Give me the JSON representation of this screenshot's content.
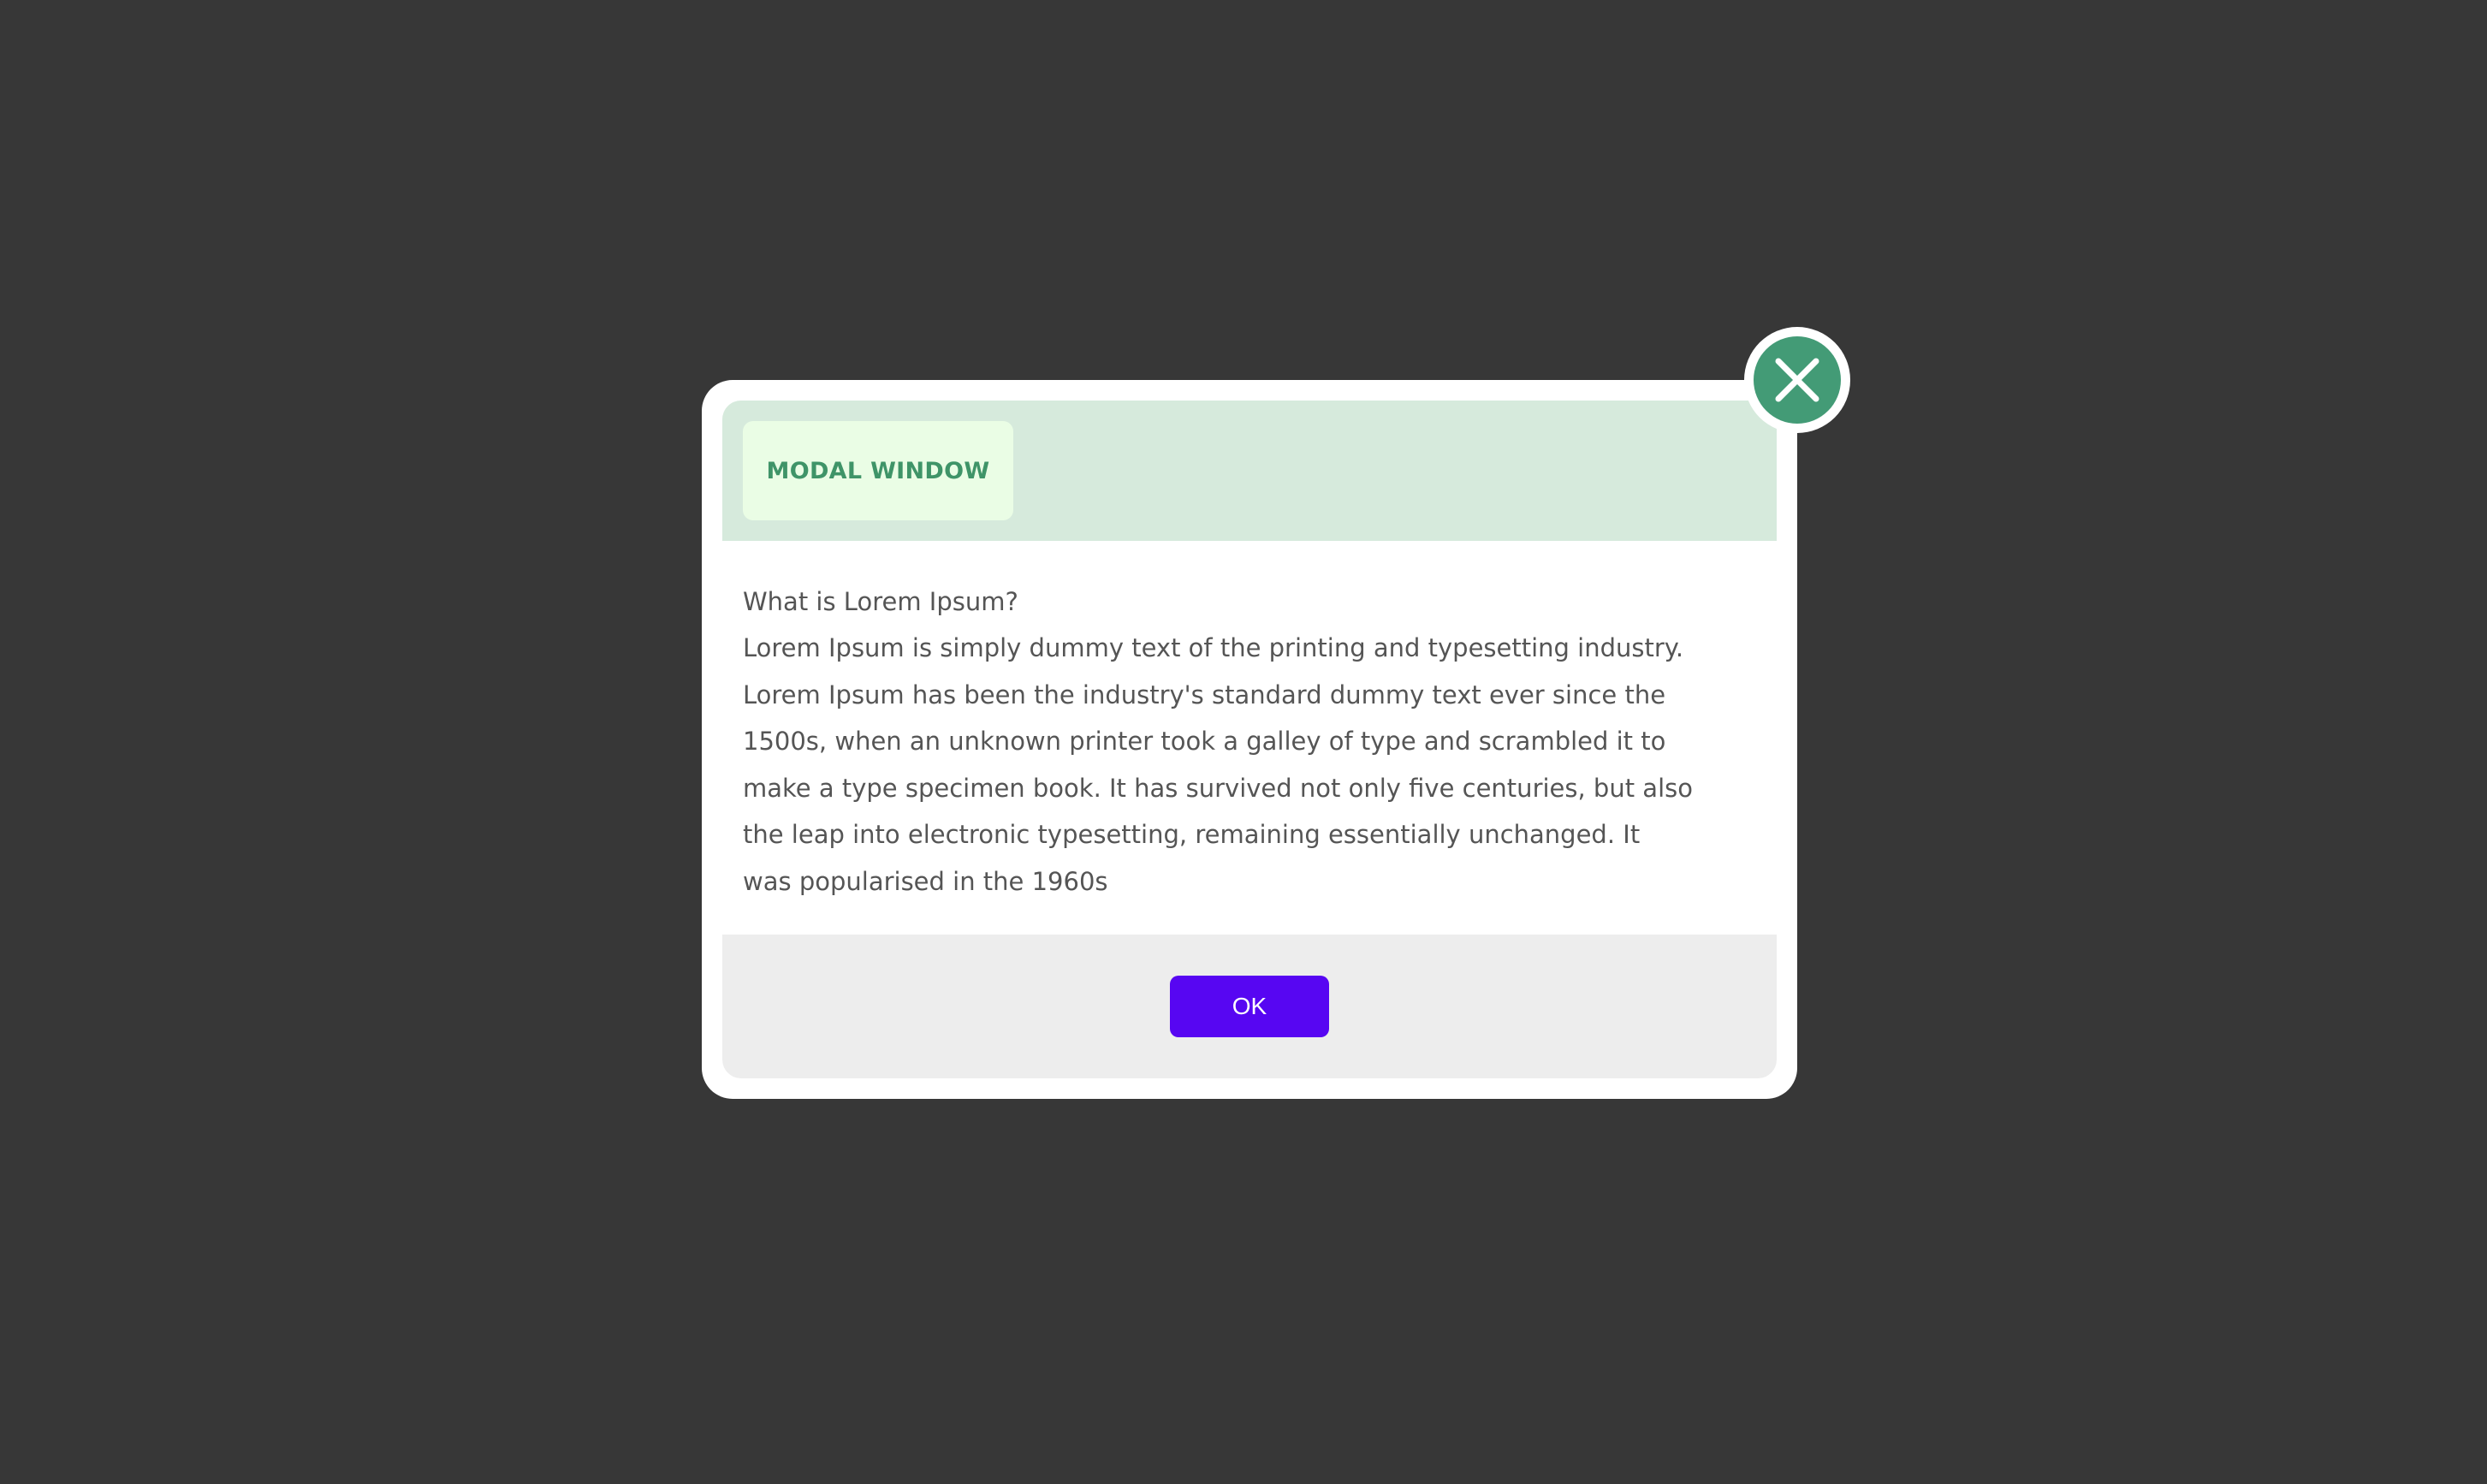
{
  "modal": {
    "title": "MODAL WINDOW",
    "body_heading": "What is Lorem Ipsum?",
    "body_text": "Lorem Ipsum is simply dummy text of the printing and typesetting industry. Lorem Ipsum has been the industry's standard dummy text ever since the 1500s, when an unknown printer took a galley of type and scrambled it to make a type specimen book. It has survived not only five centuries, but also the leap into electronic typesetting, remaining essentially unchanged. It was popularised in the 1960s",
    "ok_label": "OK",
    "close_icon": "close-icon"
  },
  "colors": {
    "page_background": "#373737",
    "header_background": "#d6eadc",
    "title_box_background": "#eafde5",
    "title_text": "#3f9468",
    "close_button": "#439b76",
    "footer_background": "#ededed",
    "ok_button": "#5706f2"
  }
}
